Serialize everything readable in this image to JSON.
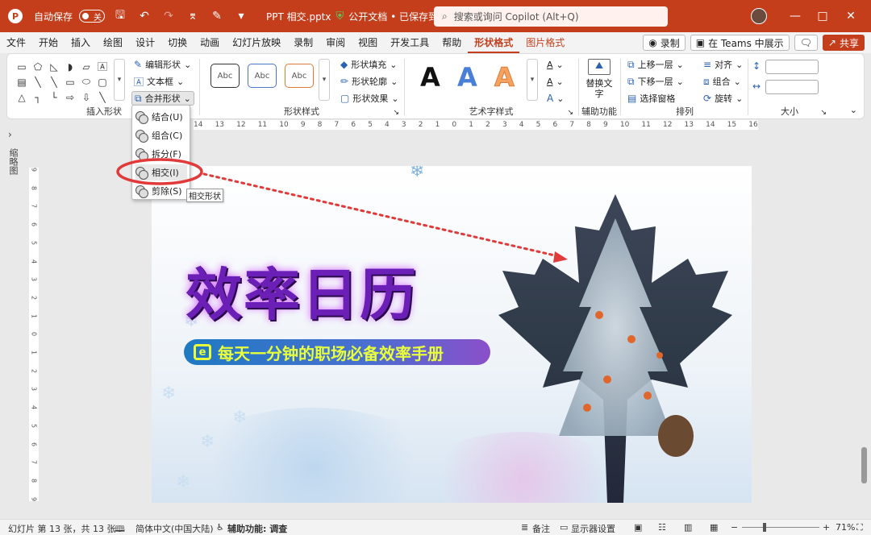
{
  "titlebar": {
    "autosave_label": "自动保存",
    "toggle_state": "关",
    "doc_name": "PPT 相交.pptx",
    "doc_status": "公开文档 • 已保存到这台电脑",
    "search_placeholder": "搜索或询问 Copilot (Alt+Q)"
  },
  "menu": {
    "tabs": [
      "文件",
      "开始",
      "插入",
      "绘图",
      "设计",
      "切换",
      "动画",
      "幻灯片放映",
      "录制",
      "审阅",
      "视图",
      "开发工具",
      "帮助",
      "形状格式",
      "图片格式"
    ],
    "active_tab": "形状格式",
    "record_label": "录制",
    "teams_label": "在 Teams 中展示",
    "share_label": "共享"
  },
  "ribbon": {
    "insert_shapes": {
      "label": "插入形状",
      "edit_shape": "编辑形状",
      "text_box": "文本框",
      "merge_shapes": "合并形状"
    },
    "shape_styles": {
      "label": "形状样式",
      "sample_text": "Abc",
      "fill": "形状填充",
      "outline": "形状轮廓",
      "effects": "形状效果"
    },
    "wordart": {
      "label": "艺术字样式",
      "sample": "A"
    },
    "accessibility": {
      "label": "辅助功能",
      "alt_text": "替换文字"
    },
    "arrange": {
      "label": "排列",
      "bring_forward": "上移一层",
      "send_backward": "下移一层",
      "selection_pane": "选择窗格",
      "align": "对齐",
      "group": "组合",
      "rotate": "旋转"
    },
    "size": {
      "label": "大小"
    }
  },
  "merge_menu": {
    "items": [
      "结合(U)",
      "组合(C)",
      "拆分(F)",
      "相交(I)",
      "剪除(S)"
    ],
    "highlighted": "相交(I)",
    "tooltip": "相交形状"
  },
  "side_panel": {
    "label": "缩略图"
  },
  "ruler": {
    "h_ticks": [
      "14",
      "13",
      "12",
      "11",
      "10",
      "9",
      "8",
      "7",
      "6",
      "5",
      "4",
      "3",
      "2",
      "1",
      "0",
      "1",
      "2",
      "3",
      "4",
      "5",
      "6",
      "7",
      "8",
      "9",
      "10",
      "11",
      "12",
      "13",
      "14",
      "15",
      "16"
    ],
    "v_ticks": [
      "9",
      "8",
      "7",
      "6",
      "5",
      "4",
      "3",
      "2",
      "1",
      "0",
      "1",
      "2",
      "3",
      "4",
      "5",
      "6",
      "7",
      "8",
      "9"
    ]
  },
  "slide": {
    "title": "效率日历",
    "pill_icon": "e",
    "subtitle": "每天一分钟的职场必备效率手册"
  },
  "statusbar": {
    "slide_info": "幻灯片 第 13 张，共 13 张",
    "language": "简体中文(中国大陆)",
    "accessibility": "辅助功能: 调查",
    "notes": "备注",
    "display_settings": "显示器设置",
    "zoom": "71%"
  },
  "colors": {
    "accent": "#c43e1c",
    "highlight_ring": "#e03a3a",
    "arrow": "#e03a3a"
  }
}
